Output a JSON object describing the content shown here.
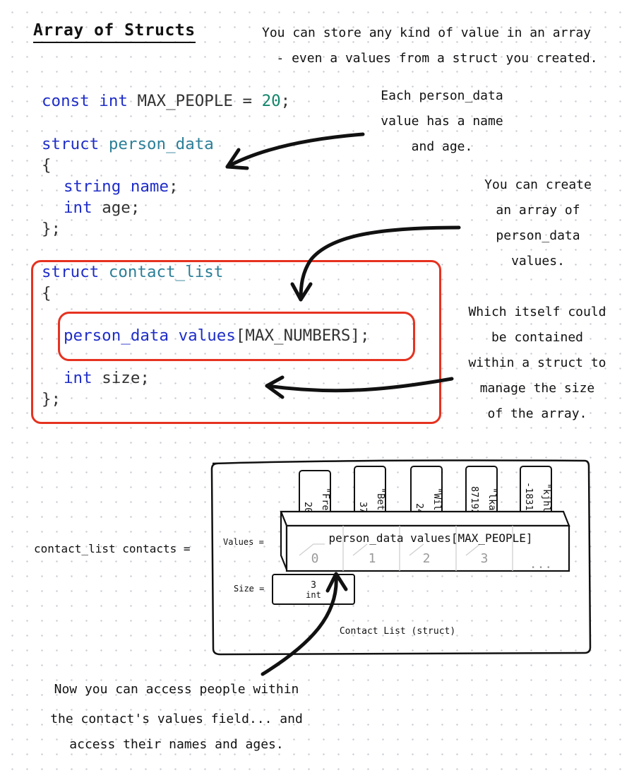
{
  "title": "Array of Structs",
  "intro": {
    "line1": "You can store any kind of value in an array",
    "line2": "- even a values from a struct you created."
  },
  "code": {
    "line1": {
      "kw": "const",
      "ty": "int",
      "rest": "MAX_PEOPLE = ",
      "num": "20",
      "end": ";"
    },
    "line2": {
      "kw": "struct",
      "name": "person_data"
    },
    "line3": "{",
    "line4": {
      "ty": "string",
      "name": "name",
      "end": ";"
    },
    "line5": {
      "ty": "int",
      "name": "age;"
    },
    "line6": "};",
    "line7": {
      "kw": "struct",
      "name": "contact_list"
    },
    "line8": "{",
    "line9": {
      "ty": "person_data",
      "name": "values",
      "rest": "[MAX_NUMBERS];"
    },
    "line10": {
      "ty": "int",
      "name": "size;"
    },
    "line11": "};"
  },
  "notes": {
    "person": [
      "Each person_data",
      "value has a name",
      "and age."
    ],
    "array": [
      "You can create",
      "an array of",
      "person_data",
      "values."
    ],
    "struct": [
      "Which itself could",
      "be contained",
      "within a struct to",
      "manage the size",
      "of the array."
    ],
    "access": [
      "Now you can access people within",
      "the contact's values field... and",
      "access their names and ages."
    ]
  },
  "diagram": {
    "var_label": "contact_list contacts =",
    "values_label": "Values =",
    "size_label": "Size =",
    "array_caption": "person_data values[MAX_PEOPLE]",
    "indices": [
      "0",
      "1",
      "2",
      "3",
      "..."
    ],
    "cards": [
      {
        "name": "\"Fred\"",
        "age": "20"
      },
      {
        "name": "\"Betty\"",
        "age": "37"
      },
      {
        "name": "\"Wilma\"",
        "age": "24"
      },
      {
        "name": "\"lkasl",
        "age": "87192"
      },
      {
        "name": "\"kjhlkj3",
        "age": "-183189"
      }
    ],
    "size_value": "3",
    "size_type": "int",
    "struct_caption": "Contact List (struct)"
  },
  "colors": {
    "keyword": "#1f2ec8",
    "type": "#2c7f98",
    "number": "#12856a",
    "highlight_box": "#e63220"
  }
}
